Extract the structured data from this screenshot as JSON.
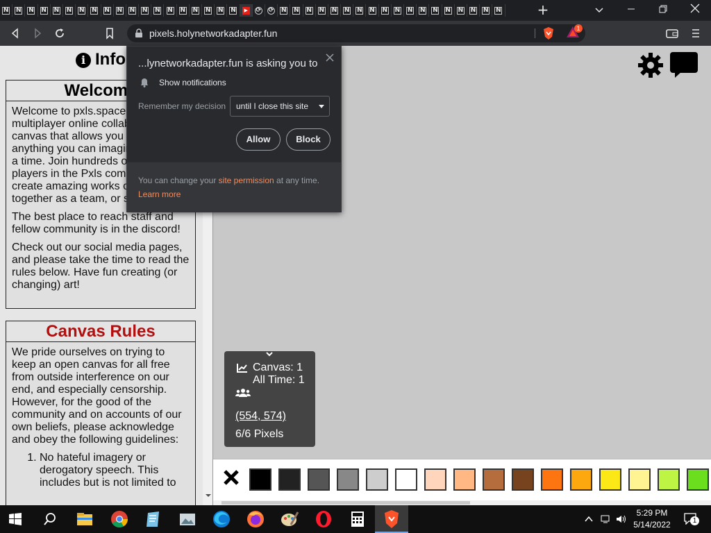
{
  "browser": {
    "url": "pixels.holynetworkadapter.fun",
    "tab_count_visible": 40,
    "brave_badge": "1"
  },
  "popup": {
    "title": "...lynetworkadapter.fun is asking you to",
    "permission": "Show notifications",
    "remember_label": "Remember my decision",
    "remember_value": "until I close this site",
    "allow": "Allow",
    "block": "Block",
    "footer_prefix": "You can change your ",
    "footer_link": "site permission",
    "footer_suffix": " at any time.",
    "learn_more": "Learn more"
  },
  "info": {
    "header": "Info",
    "welcome_title": "Welcome",
    "welcome_p1": "Welcome to pxls.space, a multiplayer online collaborative canvas that allows you to create anything you can imagine, a pixel at a time. Join hundreds of other players in the Pxls community to create amazing works of art together as a team, or solo!",
    "welcome_p2": "The best place to reach staff and fellow community is in the discord!",
    "welcome_p3": "Check out our social media pages, and please take the time to read the rules below. Have fun creating (or changing) art!",
    "rules_title": "Canvas Rules",
    "rules_title_color": "#b01010",
    "rules_intro": "We pride ourselves on trying to keep an open canvas for all free from outside interference on our end, and especially censorship. However, for the good of the community and on accounts of our own beliefs, please acknowledge and obey the following guidelines:",
    "rule_1": "No hateful imagery or derogatory speech. This includes but is not limited to"
  },
  "stats": {
    "canvas": "Canvas: 1",
    "all_time": "All Time: 1",
    "coords": "(554, 574)",
    "pixels": "6/6 Pixels"
  },
  "palette": [
    "#000000",
    "#222222",
    "#555555",
    "#888888",
    "#cdcdcd",
    "#ffffff",
    "#ffd5bc",
    "#ffb783",
    "#b66d3d",
    "#77431f",
    "#fc7510",
    "#fca80e",
    "#fde817",
    "#fff491",
    "#bef544",
    "#6bdf1e"
  ],
  "taskbar": {
    "time": "5:29 PM",
    "date": "5/14/2022",
    "notif_count": "1"
  }
}
